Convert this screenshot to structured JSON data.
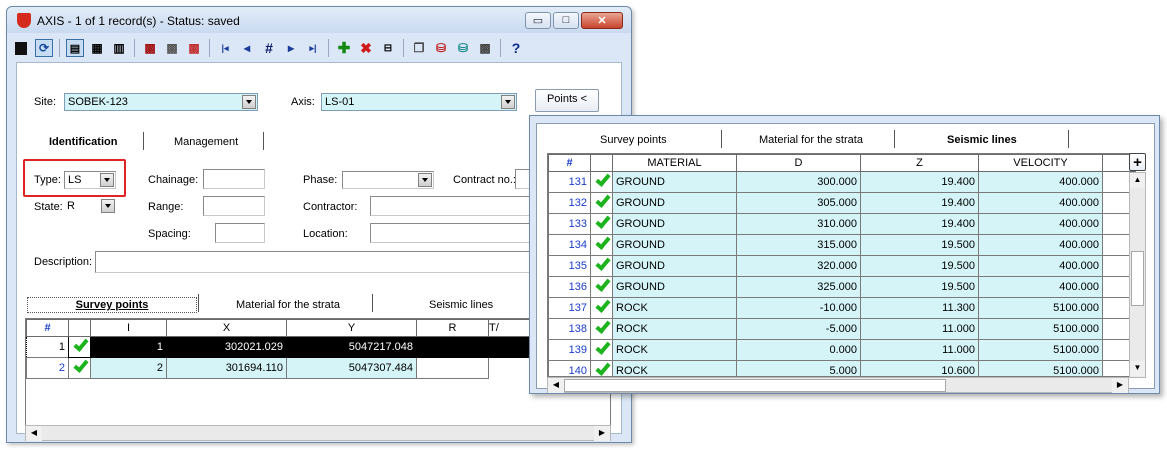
{
  "window": {
    "title": "AXIS - 1 of 1 record(s) - Status: saved",
    "controls": {
      "minimize": "▭",
      "maximize": "□",
      "close": "✕"
    }
  },
  "toolbar": {
    "icons": [
      "save-icon",
      "refresh-icon",
      "form-view-icon",
      "grid-view-icon",
      "split-view-icon",
      "db-red-icon",
      "db-grid-icon",
      "db-delete-icon",
      "first-record-icon",
      "prev-record-icon",
      "goto-record-icon",
      "next-record-icon",
      "last-record-icon",
      "add-record-icon",
      "delete-record-icon",
      "link-icon",
      "copy-db-icon",
      "export-icon",
      "import-icon",
      "tools-icon",
      "help-icon"
    ],
    "glyphs": {
      "first": "|◂",
      "prev": "◂",
      "goto": "#",
      "next": "▸",
      "last": "▸|",
      "add": "✚",
      "delete": "✖",
      "help": "?"
    }
  },
  "site": {
    "label": "Site:",
    "value": "SOBEK-123"
  },
  "axis": {
    "label": "Axis:",
    "value": "LS-01"
  },
  "points_button": "Points <",
  "tabs_top": {
    "identification": "Identification",
    "management": "Management"
  },
  "form": {
    "type_label": "Type:",
    "type_value": "LS",
    "state_label": "State:",
    "state_value": "R",
    "chainage_label": "Chainage:",
    "range_label": "Range:",
    "spacing_label": "Spacing:",
    "phase_label": "Phase:",
    "contractor_label": "Contractor:",
    "location_label": "Location:",
    "contract_label": "Contract no.:",
    "description_label": "Description:"
  },
  "tabs_bottom": {
    "survey": "Survey points",
    "material": "Material for the strata",
    "seismic": "Seismic lines"
  },
  "grid1": {
    "headers": [
      "#",
      "",
      "I",
      "X",
      "Y",
      "R",
      "T/"
    ],
    "rows": [
      {
        "n": "1",
        "i": "1",
        "x": "302021.029",
        "y": "5047217.048"
      },
      {
        "n": "2",
        "i": "2",
        "x": "301694.110",
        "y": "5047307.484"
      }
    ]
  },
  "popup": {
    "tabs": {
      "survey": "Survey points",
      "material": "Material for the strata",
      "seismic": "Seismic lines"
    },
    "headers": [
      "#",
      "",
      "MATERIAL",
      "D",
      "Z",
      "VELOCITY"
    ],
    "add_glyph": "+",
    "rows": [
      {
        "n": "131",
        "material": "GROUND",
        "d": "300.000",
        "z": "19.400",
        "v": "400.000"
      },
      {
        "n": "132",
        "material": "GROUND",
        "d": "305.000",
        "z": "19.400",
        "v": "400.000"
      },
      {
        "n": "133",
        "material": "GROUND",
        "d": "310.000",
        "z": "19.400",
        "v": "400.000"
      },
      {
        "n": "134",
        "material": "GROUND",
        "d": "315.000",
        "z": "19.500",
        "v": "400.000"
      },
      {
        "n": "135",
        "material": "GROUND",
        "d": "320.000",
        "z": "19.500",
        "v": "400.000"
      },
      {
        "n": "136",
        "material": "GROUND",
        "d": "325.000",
        "z": "19.500",
        "v": "400.000"
      },
      {
        "n": "137",
        "material": "ROCK",
        "d": "-10.000",
        "z": "11.300",
        "v": "5100.000"
      },
      {
        "n": "138",
        "material": "ROCK",
        "d": "-5.000",
        "z": "11.000",
        "v": "5100.000"
      },
      {
        "n": "139",
        "material": "ROCK",
        "d": "0.000",
        "z": "11.000",
        "v": "5100.000"
      },
      {
        "n": "140",
        "material": "ROCK",
        "d": "5.000",
        "z": "10.600",
        "v": "5100.000"
      }
    ]
  },
  "colors": {
    "cyan_field": "#d5f4f7",
    "check_green": "#1db31d",
    "highlight_red": "#e02424",
    "row_number_blue": "#1a3ccc"
  }
}
